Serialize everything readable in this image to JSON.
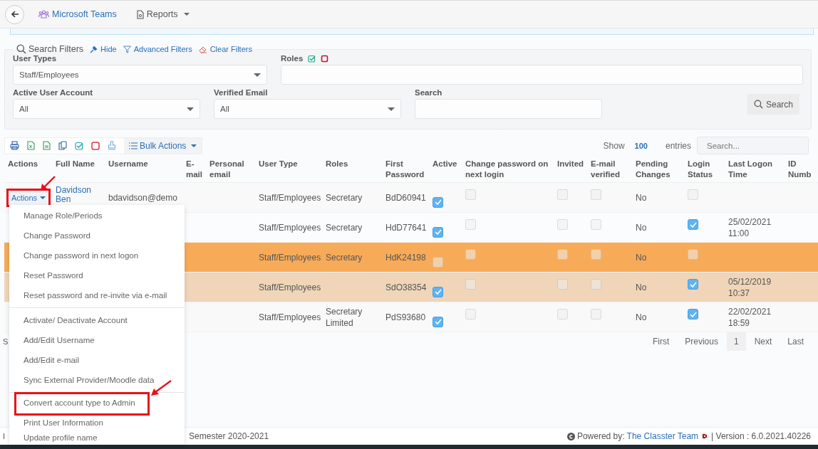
{
  "topbar": {
    "links": [
      {
        "label": "Microsoft Teams",
        "kind": "teams"
      },
      {
        "label": "Reports",
        "kind": "dropdown"
      }
    ]
  },
  "filters": {
    "title": "Search Filters",
    "links": [
      {
        "label": "Hide",
        "kind": "pin"
      },
      {
        "label": "Advanced Filters",
        "kind": "funnel"
      },
      {
        "label": "Clear Filters",
        "kind": "eraser"
      }
    ],
    "user_types": {
      "label": "User Types",
      "value": "Staff/Employees"
    },
    "roles": {
      "label": "Roles"
    },
    "active_user_account": {
      "label": "Active User Account",
      "value": "All"
    },
    "verified_email": {
      "label": "Verified Email",
      "value": "All"
    },
    "search": {
      "label": "Search"
    },
    "search_button": "Search"
  },
  "toolbar": {
    "bulk_actions": "Bulk Actions",
    "show_label": "Show",
    "page_size": "100",
    "entries_label": "entries",
    "search_placeholder": "Search..."
  },
  "table": {
    "columns": [
      "Actions",
      "Full Name",
      "Username",
      "E-mail",
      "Personal email",
      "User Type",
      "Roles",
      "First Password",
      "Active",
      "Change password on next login",
      "Invited",
      "E-mail verified",
      "Pending Changes",
      "Login Status",
      "Last Logon Time",
      "ID Numb"
    ],
    "rows": [
      {
        "color": "#f9f9f9",
        "full_name": "Davidson Ben",
        "username": "bdavidson@demo",
        "user_type": "Staff/Employees",
        "roles": "Secretary",
        "first_password": "BdD60941",
        "active": true,
        "change_password": false,
        "invited": false,
        "email_verified": false,
        "pending_changes": "No",
        "login_status": false
      },
      {
        "color": "#fbfcfe",
        "user_type": "Staff/Employees",
        "roles": "Secretary",
        "first_password": "HdD77641",
        "active": true,
        "change_password": false,
        "invited": false,
        "email_verified": false,
        "pending_changes": "No",
        "login_status": true,
        "last_logon": "25/02/2021 11:00"
      },
      {
        "color": "#f7ab59",
        "user_type": "Staff/Employees",
        "roles": "Secretary",
        "first_password": "HdK24198",
        "active": false,
        "change_password": false,
        "invited": false,
        "email_verified": false,
        "pending_changes": "No",
        "login_status": false
      },
      {
        "color": "#f0d5b8",
        "user_type": "Staff/Employees",
        "first_password": "SdO38354",
        "active": true,
        "change_password": false,
        "invited": false,
        "email_verified": false,
        "pending_changes": "No",
        "login_status": true,
        "last_logon": "05/12/2019 10:37"
      },
      {
        "color": "#f9f9f9",
        "user_type": "Staff/Employees",
        "roles": "Secretary Limited",
        "first_password": "PdS93680",
        "active": true,
        "change_password": false,
        "invited": false,
        "email_verified": false,
        "pending_changes": "No",
        "login_status": true,
        "last_logon": "22/02/2021 18:59"
      }
    ]
  },
  "actions_menu": {
    "button": "Actions",
    "highlighted": true,
    "groups": [
      [
        {
          "label": "Manage Role/Periods",
          "highlighted": false
        },
        {
          "label": "Change Password",
          "highlighted": false
        },
        {
          "label": "Change password in next logon",
          "highlighted": false
        },
        {
          "label": "Reset Password",
          "highlighted": false
        },
        {
          "label": "Reset password and re-invite via e-mail",
          "highlighted": false
        }
      ],
      [
        {
          "label": "Activate/ Deactivate Account",
          "highlighted": false
        },
        {
          "label": "Add/Edit Username",
          "highlighted": false
        },
        {
          "label": "Add/Edit e-mail",
          "highlighted": false
        },
        {
          "label": "Sync External Provider/Moodle data",
          "highlighted": false
        }
      ],
      [
        {
          "label": "Convert account type to Admin",
          "highlighted": true
        },
        {
          "label": "Print User Information",
          "highlighted": false
        },
        {
          "label": "Update profile name",
          "highlighted": false
        }
      ]
    ]
  },
  "table_info": "S",
  "pagination": {
    "first": "First",
    "previous": "Previous",
    "pages": [
      {
        "label": "1",
        "selected": true
      }
    ],
    "next": "Next",
    "last": "Last"
  },
  "footer": {
    "left": "I",
    "period": "Semester 2020-2021",
    "powered_by": "Powered by:",
    "team": "The Classter Team",
    "version": "| Version : 6.0.2021.40226"
  }
}
